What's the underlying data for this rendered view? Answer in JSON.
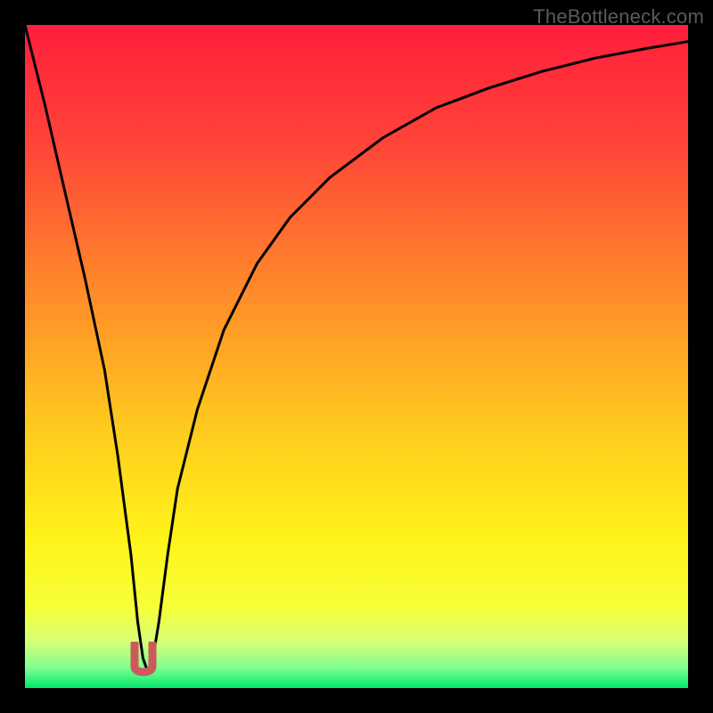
{
  "watermark": {
    "text": "TheBottleneck.com"
  },
  "chart_data": {
    "type": "line",
    "title": "",
    "xlabel": "",
    "ylabel": "",
    "xlim": [
      0,
      100
    ],
    "ylim": [
      0,
      100
    ],
    "grid": false,
    "legend": false,
    "background_gradient_stops": [
      {
        "offset": 0.0,
        "color": "#ff1e3c"
      },
      {
        "offset": 0.18,
        "color": "#ff4438"
      },
      {
        "offset": 0.4,
        "color": "#ff8a2a"
      },
      {
        "offset": 0.6,
        "color": "#ffc81e"
      },
      {
        "offset": 0.78,
        "color": "#fff41a"
      },
      {
        "offset": 0.88,
        "color": "#f6ff3a"
      },
      {
        "offset": 0.93,
        "color": "#d6ff78"
      },
      {
        "offset": 0.97,
        "color": "#7dff8f"
      },
      {
        "offset": 1.0,
        "color": "#00e86e"
      }
    ],
    "series": [
      {
        "name": "bottleneck-curve",
        "x": [
          0,
          3,
          6,
          9,
          12,
          14,
          16,
          17.0,
          17.8,
          18.5,
          19.3,
          20.2,
          21.5,
          23,
          26,
          30,
          35,
          40,
          46,
          54,
          62,
          70,
          78,
          86,
          94,
          100
        ],
        "y": [
          100,
          88,
          75,
          62,
          48,
          35,
          20,
          10,
          4.5,
          2.5,
          4.5,
          10,
          20,
          30,
          42,
          54,
          64,
          71,
          77,
          83,
          87.5,
          90.5,
          93,
          95,
          96.5,
          97.5
        ]
      }
    ],
    "marker": {
      "name": "optimal-point",
      "shape": "U",
      "color": "#cc5a5a",
      "x": 18.5,
      "y": 3
    }
  }
}
